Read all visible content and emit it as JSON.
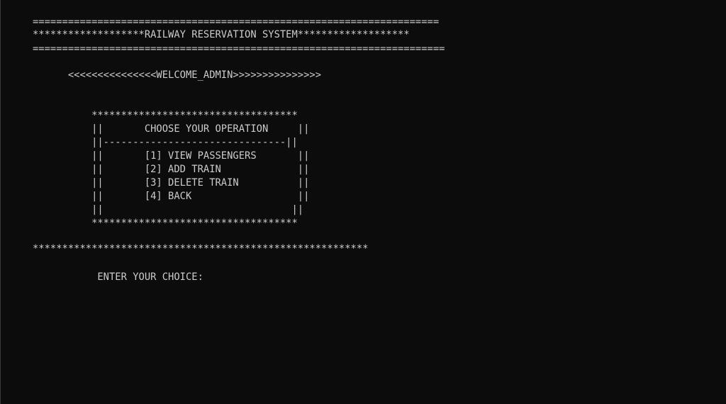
{
  "console": {
    "lines": [
      "=====================================================================",
      "*******************RAILWAY RESERVATION SYSTEM*******************",
      "======================================================================",
      "      <<<<<<<<<<<<<<<WELCOME_ADMIN>>>>>>>>>>>>>>>",
      "          ***********************************",
      "          ||       CHOOSE YOUR OPERATION     ||",
      "          ||-------------------------------||",
      "          ||       [1] VIEW PASSENGERS       ||",
      "          ||       [2] ADD TRAIN             ||",
      "          ||       [3] DELETE TRAIN          ||",
      "          ||       [4] BACK                  ||",
      "          ||                                ||",
      "          ***********************************",
      "*********************************************************",
      "           ENTER YOUR CHOICE:"
    ]
  }
}
